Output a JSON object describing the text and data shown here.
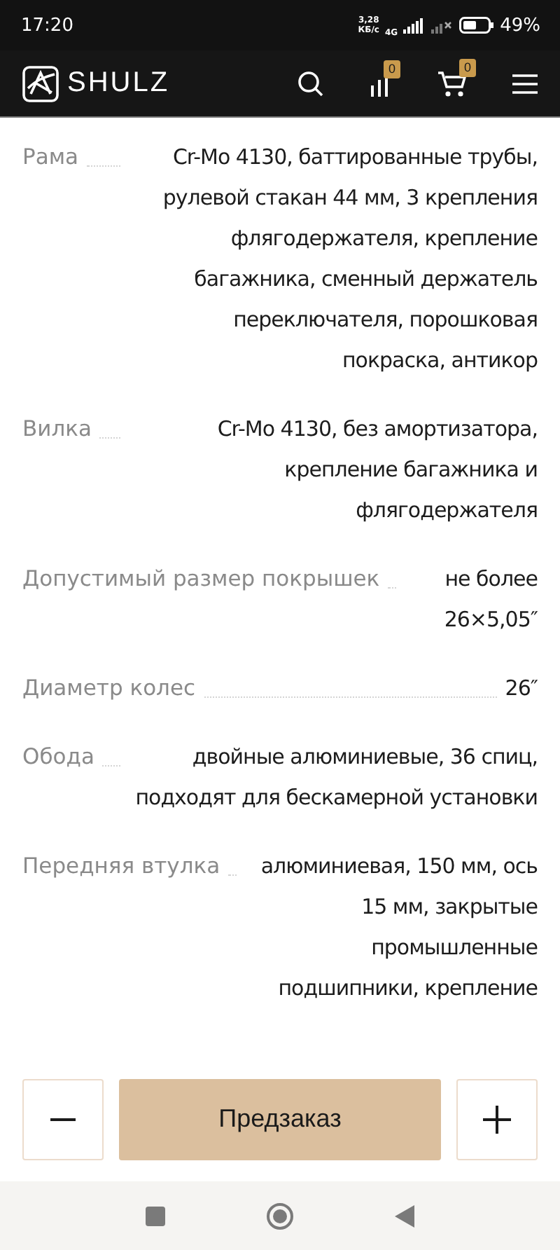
{
  "status_bar": {
    "time": "17:20",
    "net_speed": "3,28",
    "net_unit": "КБ/с",
    "network": "4G",
    "battery": "49%"
  },
  "header": {
    "logo": "SHULZ",
    "compare_count": "0",
    "cart_count": "0"
  },
  "specs": [
    {
      "label": "Рама",
      "value": "Cr-Mo 4130, баттированные трубы, рулевой стакан 44 мм, 3 крепления флягодержателя, крепление багажника, сменный держатель переключателя, порошковая покраска, антикор"
    },
    {
      "label": "Вилка",
      "value": "Cr-Mo 4130, без амортизатора, крепление багажника и флягодержателя"
    },
    {
      "label": "Допустимый размер покрышек",
      "value": "не более 26×5,05″"
    },
    {
      "label": "Диаметр колес",
      "value": "26″"
    },
    {
      "label": "Обода",
      "value": "двойные алюминиевые, 36 спиц, подходят для бескамерной установки"
    },
    {
      "label": "Передняя втулка",
      "value": "алюминиевая, 150 мм, ось 15 мм, закрытые промышленные подшипники, крепление"
    }
  ],
  "footer": {
    "order_button": "Предзаказ"
  }
}
